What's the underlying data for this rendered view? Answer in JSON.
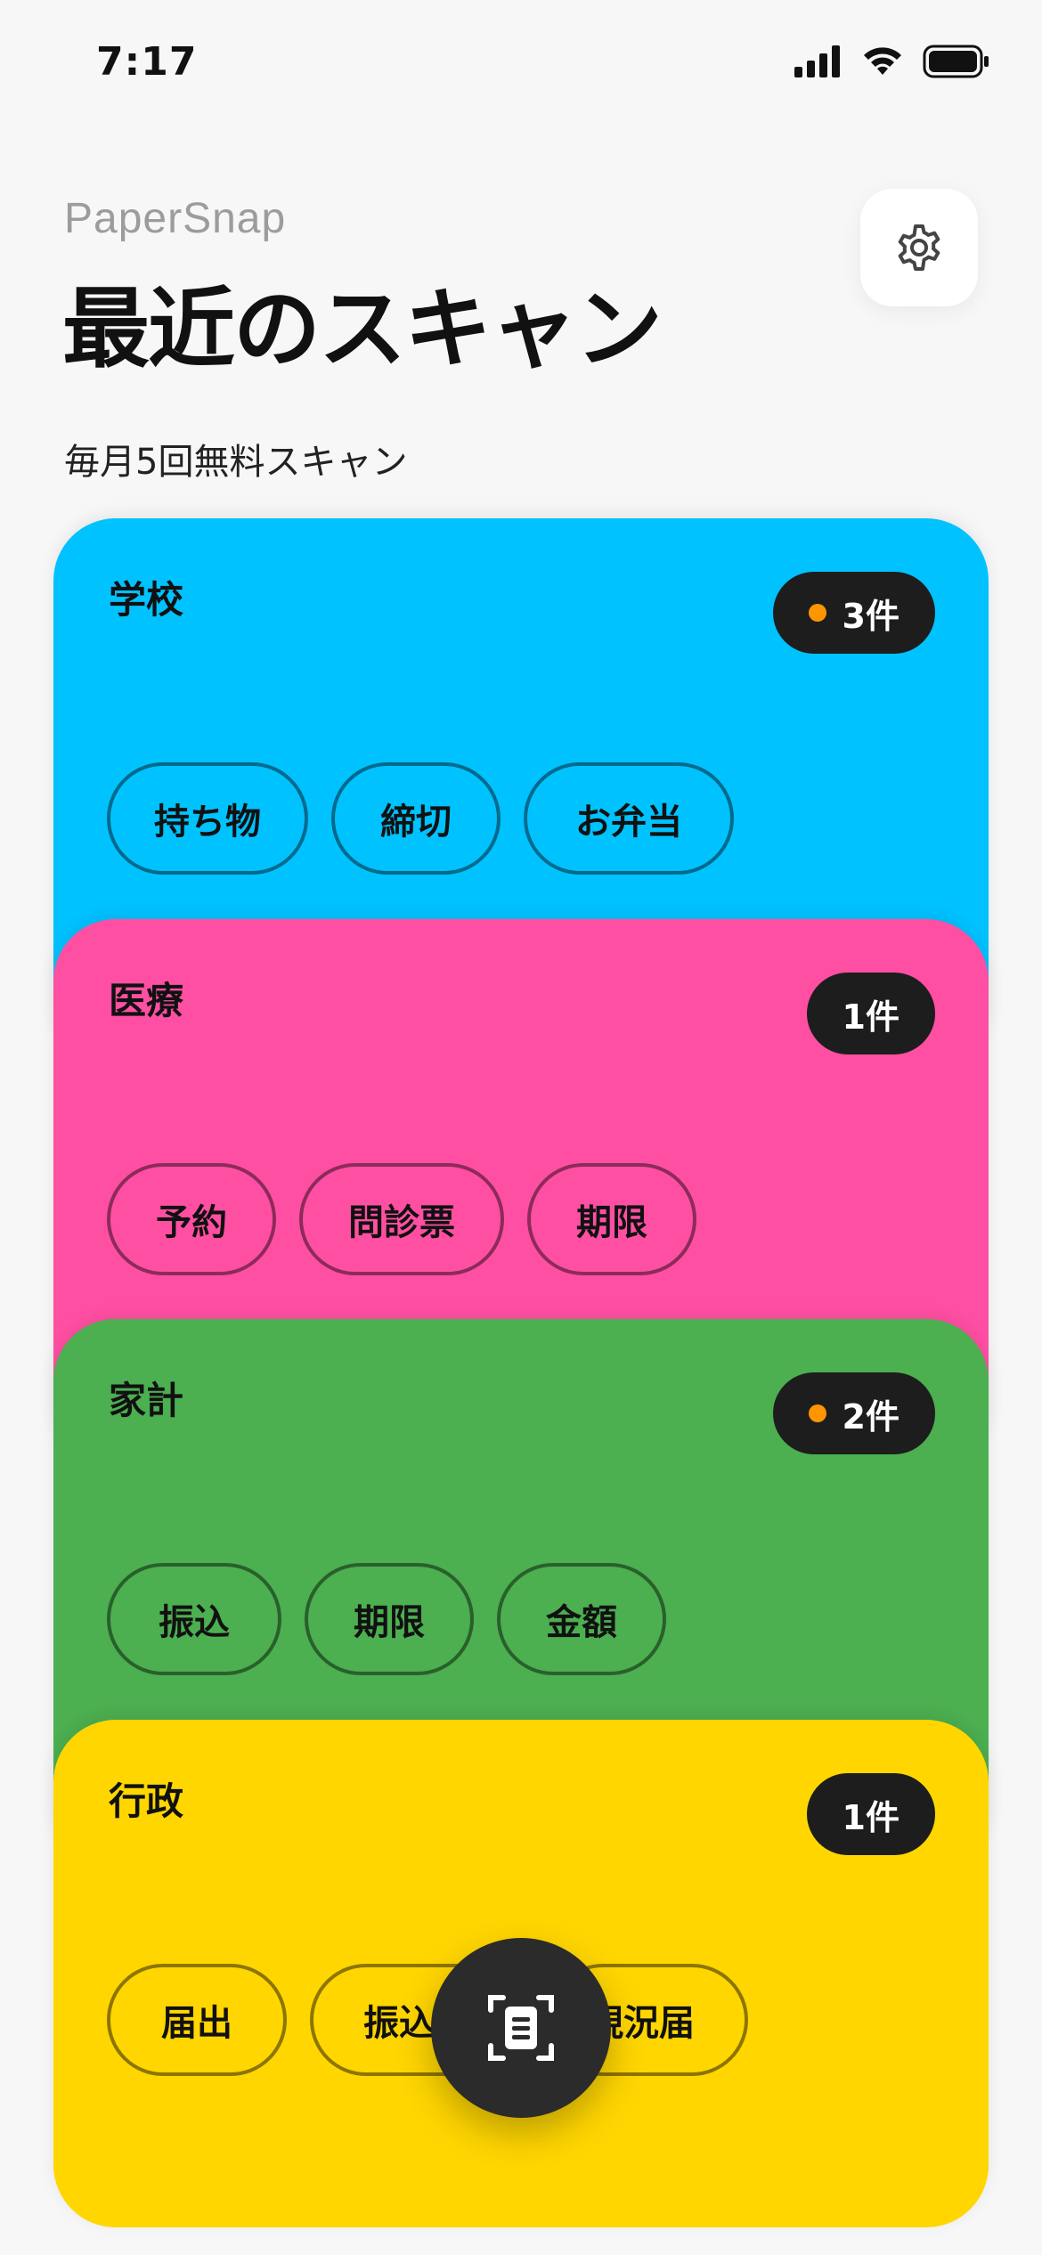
{
  "status_bar": {
    "time": "7:17"
  },
  "header": {
    "app_name": "PaperSnap",
    "title": "最近のスキャン",
    "subtitle": "毎月5回無料スキャン",
    "settings_icon": "gear-icon"
  },
  "cards": [
    {
      "label": "学校",
      "count": "3件",
      "unread_dot": true,
      "color": "#00C2FF",
      "chips": [
        "持ち物",
        "締切",
        "お弁当"
      ]
    },
    {
      "label": "医療",
      "count": "1件",
      "unread_dot": false,
      "color": "#FF4FA3",
      "chips": [
        "予約",
        "問診票",
        "期限"
      ]
    },
    {
      "label": "家計",
      "count": "2件",
      "unread_dot": true,
      "color": "#4CAF50",
      "chips": [
        "振込",
        "期限",
        "金額"
      ]
    },
    {
      "label": "行政",
      "count": "1件",
      "unread_dot": false,
      "color": "#FFD600",
      "chips": [
        "届出",
        "振込",
        "現況届"
      ]
    }
  ],
  "fab": {
    "icon": "document-scan-icon"
  }
}
